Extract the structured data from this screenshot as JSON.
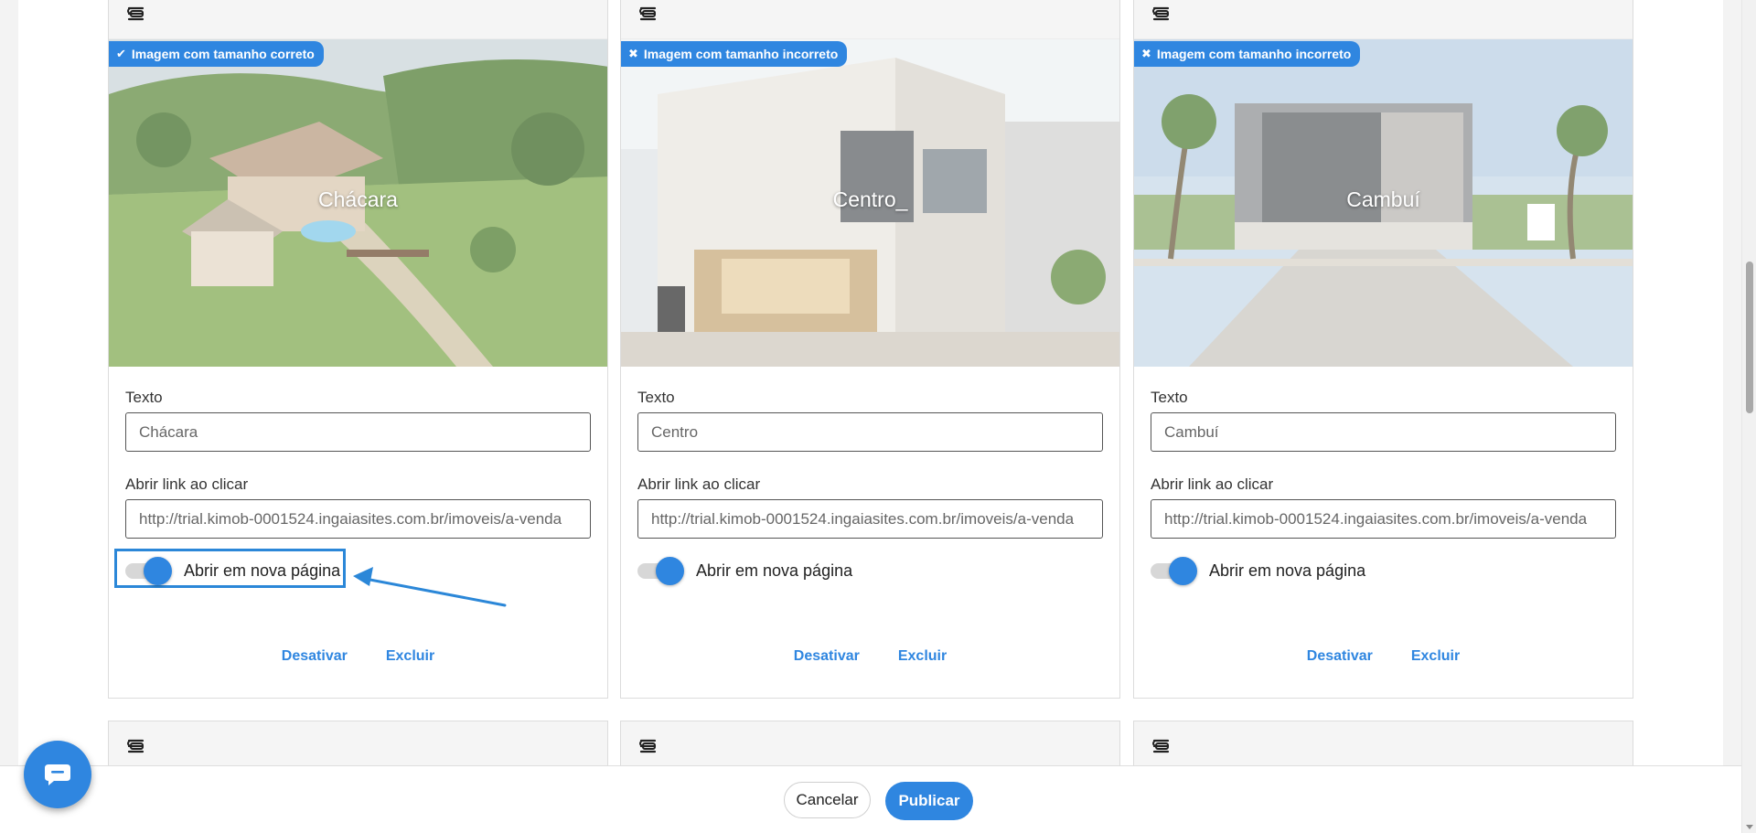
{
  "cards": [
    {
      "badge": {
        "mark": "✔",
        "text": "Imagem com tamanho correto"
      },
      "image_title": "Chácara",
      "text_label": "Texto",
      "text_value": "Chácara",
      "link_label": "Abrir link ao clicar",
      "link_value": "http://trial.kimob-0001524.ingaiasites.com.br/imoveis/a-venda",
      "toggle_label": "Abrir em nova página",
      "deactivate_label": "Desativar",
      "delete_label": "Excluir"
    },
    {
      "badge": {
        "mark": "✖",
        "text": "Imagem com tamanho incorreto"
      },
      "image_title": "Centro_",
      "text_label": "Texto",
      "text_value": "Centro",
      "link_label": "Abrir link ao clicar",
      "link_value": "http://trial.kimob-0001524.ingaiasites.com.br/imoveis/a-venda",
      "toggle_label": "Abrir em nova página",
      "deactivate_label": "Desativar",
      "delete_label": "Excluir"
    },
    {
      "badge": {
        "mark": "✖",
        "text": "Imagem com tamanho incorreto"
      },
      "image_title": "Cambuí",
      "text_label": "Texto",
      "text_value": "Cambuí",
      "link_label": "Abrir link ao clicar",
      "link_value": "http://trial.kimob-0001524.ingaiasites.com.br/imoveis/a-venda",
      "toggle_label": "Abrir em nova página",
      "deactivate_label": "Desativar",
      "delete_label": "Excluir"
    }
  ],
  "footer": {
    "cancel_label": "Cancelar",
    "publish_label": "Publicar"
  },
  "colors": {
    "accent": "#2f86e0",
    "highlight": "#2b87d8"
  },
  "icons": {
    "drag": "drag-handle-icon",
    "chat": "chat-bubble-icon"
  }
}
